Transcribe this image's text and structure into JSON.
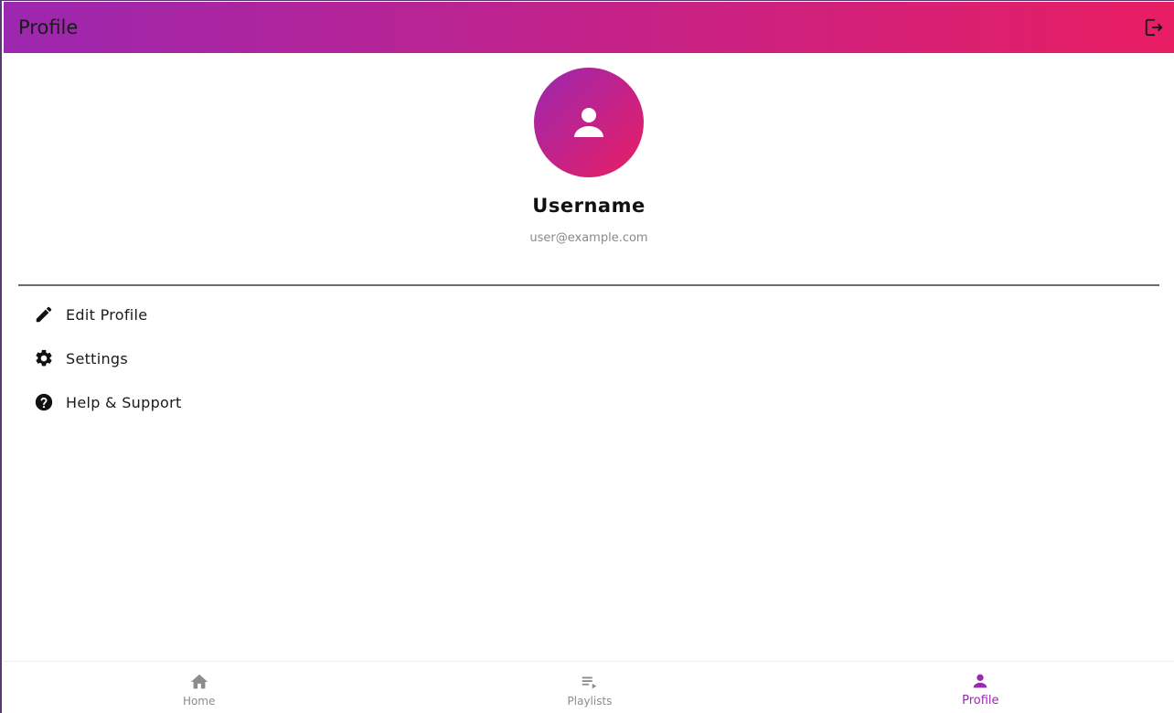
{
  "app_bar": {
    "title": "Profile",
    "logout_icon": "logout-icon"
  },
  "profile": {
    "avatar_icon": "person-icon",
    "username": "Username",
    "email": "user@example.com"
  },
  "menu": {
    "items": [
      {
        "label": "Edit Profile",
        "icon": "edit-icon"
      },
      {
        "label": "Settings",
        "icon": "settings-icon"
      },
      {
        "label": "Help & Support",
        "icon": "help-icon"
      }
    ]
  },
  "bottom_nav": {
    "items": [
      {
        "label": "Home",
        "icon": "home-icon",
        "active": false
      },
      {
        "label": "Playlists",
        "icon": "playlist-play-icon",
        "active": false
      },
      {
        "label": "Profile",
        "icon": "person-icon",
        "active": true
      }
    ]
  },
  "colors": {
    "gradient_start": "#9c27b0",
    "gradient_end": "#e91e63",
    "active_nav": "#9c27b0",
    "inactive_nav": "#8c8c8c"
  }
}
